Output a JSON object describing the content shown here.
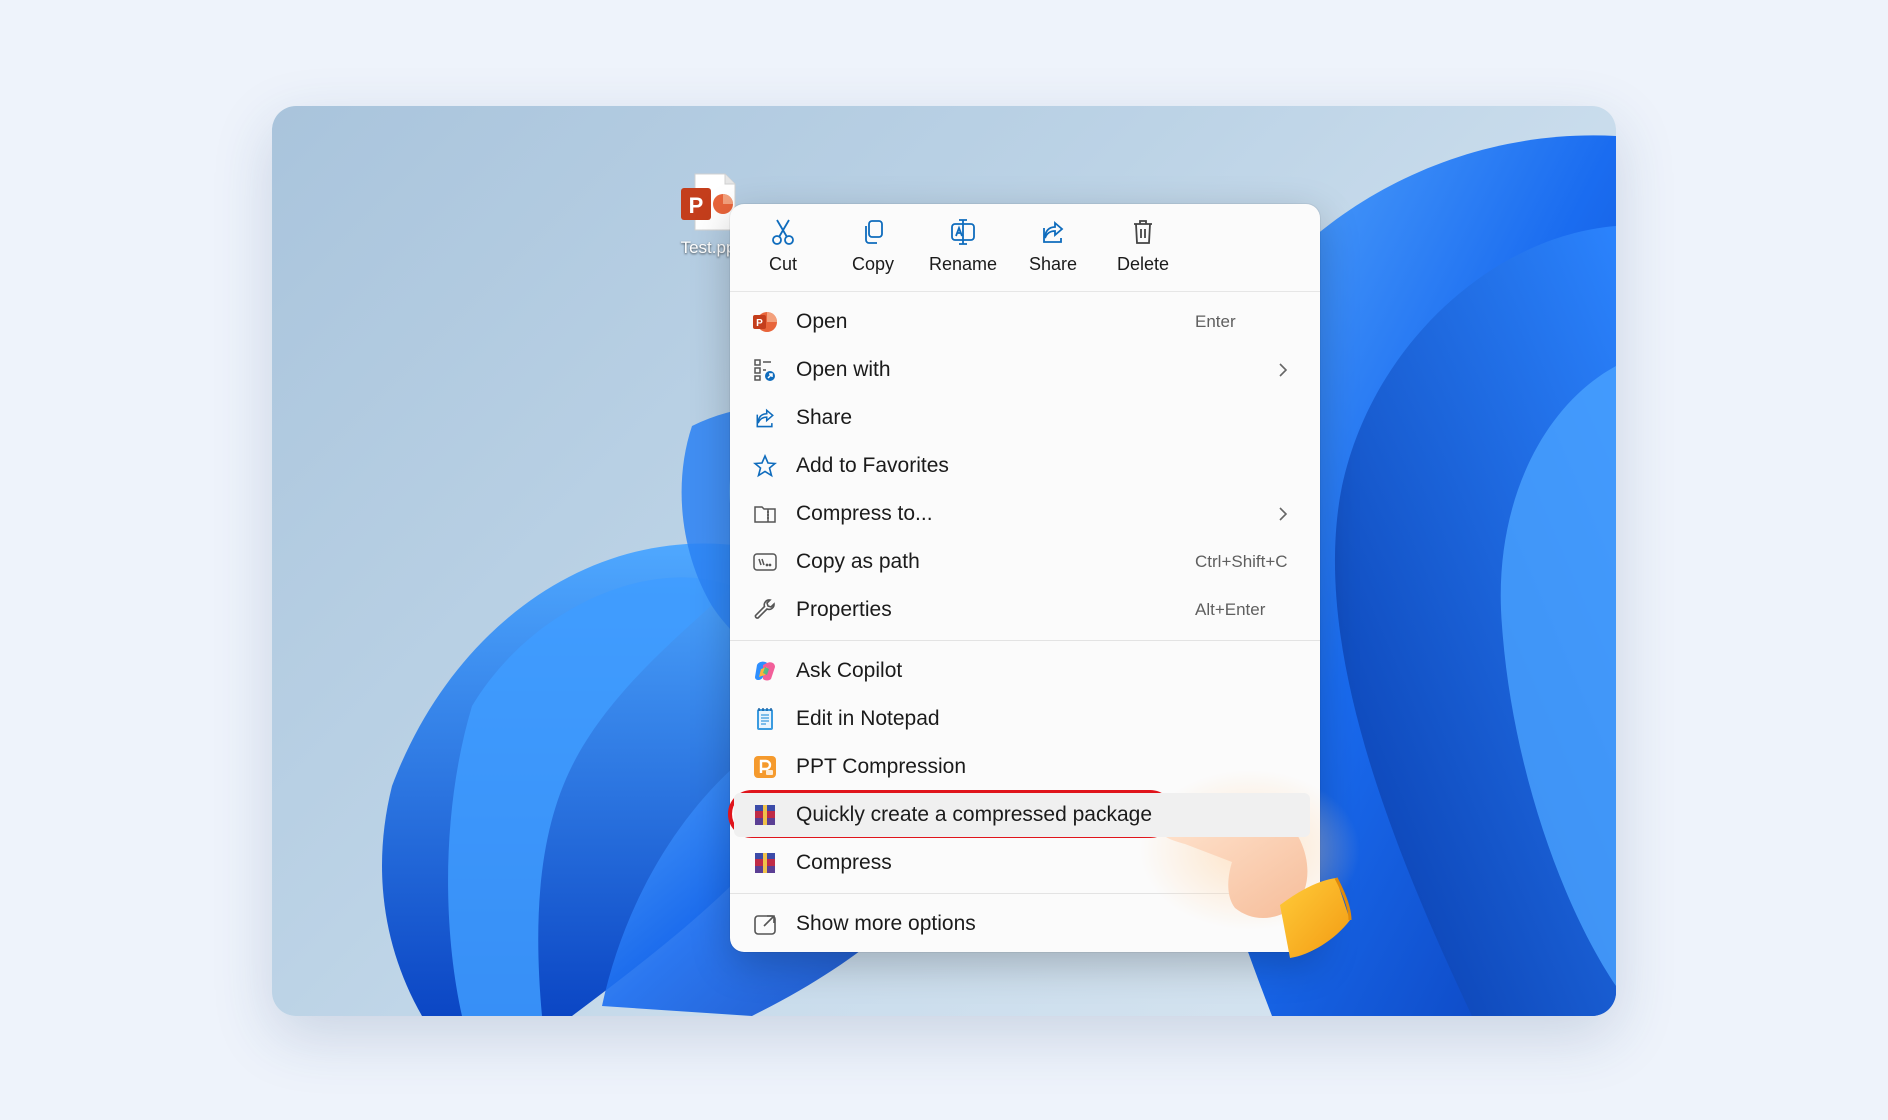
{
  "desktop": {
    "file": {
      "name": "Test.pp",
      "icon": "powerpoint-file-icon"
    }
  },
  "context_menu": {
    "toolbar": [
      {
        "label": "Cut",
        "icon": "scissors-icon"
      },
      {
        "label": "Copy",
        "icon": "copy-icon"
      },
      {
        "label": "Rename",
        "icon": "rename-icon"
      },
      {
        "label": "Share",
        "icon": "share-icon"
      },
      {
        "label": "Delete",
        "icon": "trash-icon"
      }
    ],
    "items": [
      {
        "label": "Open",
        "shortcut": "Enter",
        "icon": "powerpoint-icon"
      },
      {
        "label": "Open with",
        "submenu": true,
        "icon": "open-with-icon"
      },
      {
        "label": "Share",
        "icon": "share-icon"
      },
      {
        "label": "Add to Favorites",
        "icon": "star-icon"
      },
      {
        "label": "Compress to...",
        "submenu": true,
        "icon": "zip-folder-icon"
      },
      {
        "label": "Copy as path",
        "shortcut": "Ctrl+Shift+C",
        "icon": "path-icon"
      },
      {
        "label": "Properties",
        "shortcut": "Alt+Enter",
        "icon": "wrench-icon"
      }
    ],
    "items2": [
      {
        "label": "Ask Copilot",
        "icon": "copilot-icon"
      },
      {
        "label": "Edit in Notepad",
        "icon": "notepad-icon"
      },
      {
        "label": "PPT Compression",
        "icon": "ppt-compression-icon"
      },
      {
        "label": "Quickly create a compressed package",
        "icon": "winrar-icon",
        "highlighted": true
      },
      {
        "label": "Compress",
        "icon": "winrar-icon"
      }
    ],
    "items3": [
      {
        "label": "Show more options",
        "icon": "more-options-icon"
      }
    ]
  },
  "colors": {
    "highlight_ring": "#e0141b",
    "accent": "#0f6cbd"
  }
}
